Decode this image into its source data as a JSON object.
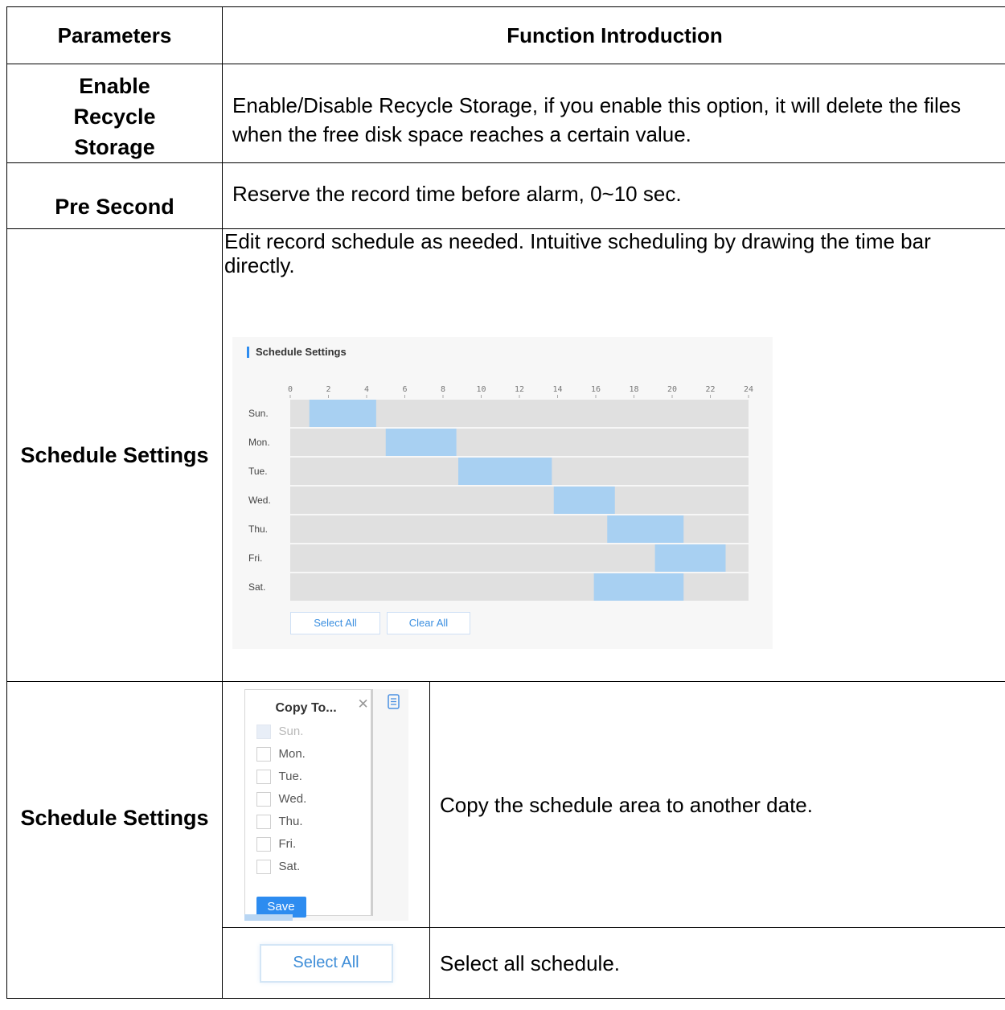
{
  "table": {
    "header": {
      "param": "Parameters",
      "function": "Function Introduction"
    },
    "rows": [
      {
        "param": "Enable Recycle Storage",
        "param_lines": [
          "Enable",
          "Recycle",
          "Storage"
        ],
        "desc": "Enable/Disable Recycle Storage, if you enable this option, it will delete the files when the free disk space reaches a certain value."
      },
      {
        "param": "Pre Second",
        "desc": "Reserve the record time before alarm, 0~10 sec."
      },
      {
        "param": "Schedule Settings",
        "desc": "Edit record schedule as needed. Intuitive scheduling by drawing the time bar directly."
      },
      {
        "param": "Schedule Settings",
        "copy_desc": "Copy the schedule area to another date.",
        "select_desc": "Select all schedule."
      }
    ]
  },
  "schedule_panel": {
    "title": "Schedule Settings",
    "hours": [
      "0",
      "2",
      "4",
      "6",
      "8",
      "10",
      "12",
      "14",
      "16",
      "18",
      "20",
      "22",
      "24"
    ],
    "days": [
      "Sun.",
      "Mon.",
      "Tue.",
      "Wed.",
      "Thu.",
      "Fri.",
      "Sat."
    ],
    "blocks": [
      {
        "day": "Sun.",
        "start": 1,
        "end": 4.5
      },
      {
        "day": "Mon.",
        "start": 5,
        "end": 8.7
      },
      {
        "day": "Tue.",
        "start": 8.8,
        "end": 13.7
      },
      {
        "day": "Wed.",
        "start": 13.8,
        "end": 17
      },
      {
        "day": "Thu.",
        "start": 16.6,
        "end": 20.6
      },
      {
        "day": "Fri.",
        "start": 19.1,
        "end": 22.8
      },
      {
        "day": "Sat.",
        "start": 15.9,
        "end": 20.6
      }
    ],
    "select_all": "Select All",
    "clear_all": "Clear All",
    "colors": {
      "block": "#a8d0f2",
      "grid": "#e0e0e0",
      "accent": "#2d8cf0"
    }
  },
  "copy_popup": {
    "title": "Copy To...",
    "close_icon": "close-icon",
    "copy_icon": "copy-icon",
    "days": [
      {
        "label": "Sun.",
        "disabled": true
      },
      {
        "label": "Mon.",
        "disabled": false
      },
      {
        "label": "Tue.",
        "disabled": false
      },
      {
        "label": "Wed.",
        "disabled": false
      },
      {
        "label": "Thu.",
        "disabled": false
      },
      {
        "label": "Fri.",
        "disabled": false
      },
      {
        "label": "Sat.",
        "disabled": false
      }
    ],
    "save": "Save"
  },
  "select_all_button": "Select All"
}
